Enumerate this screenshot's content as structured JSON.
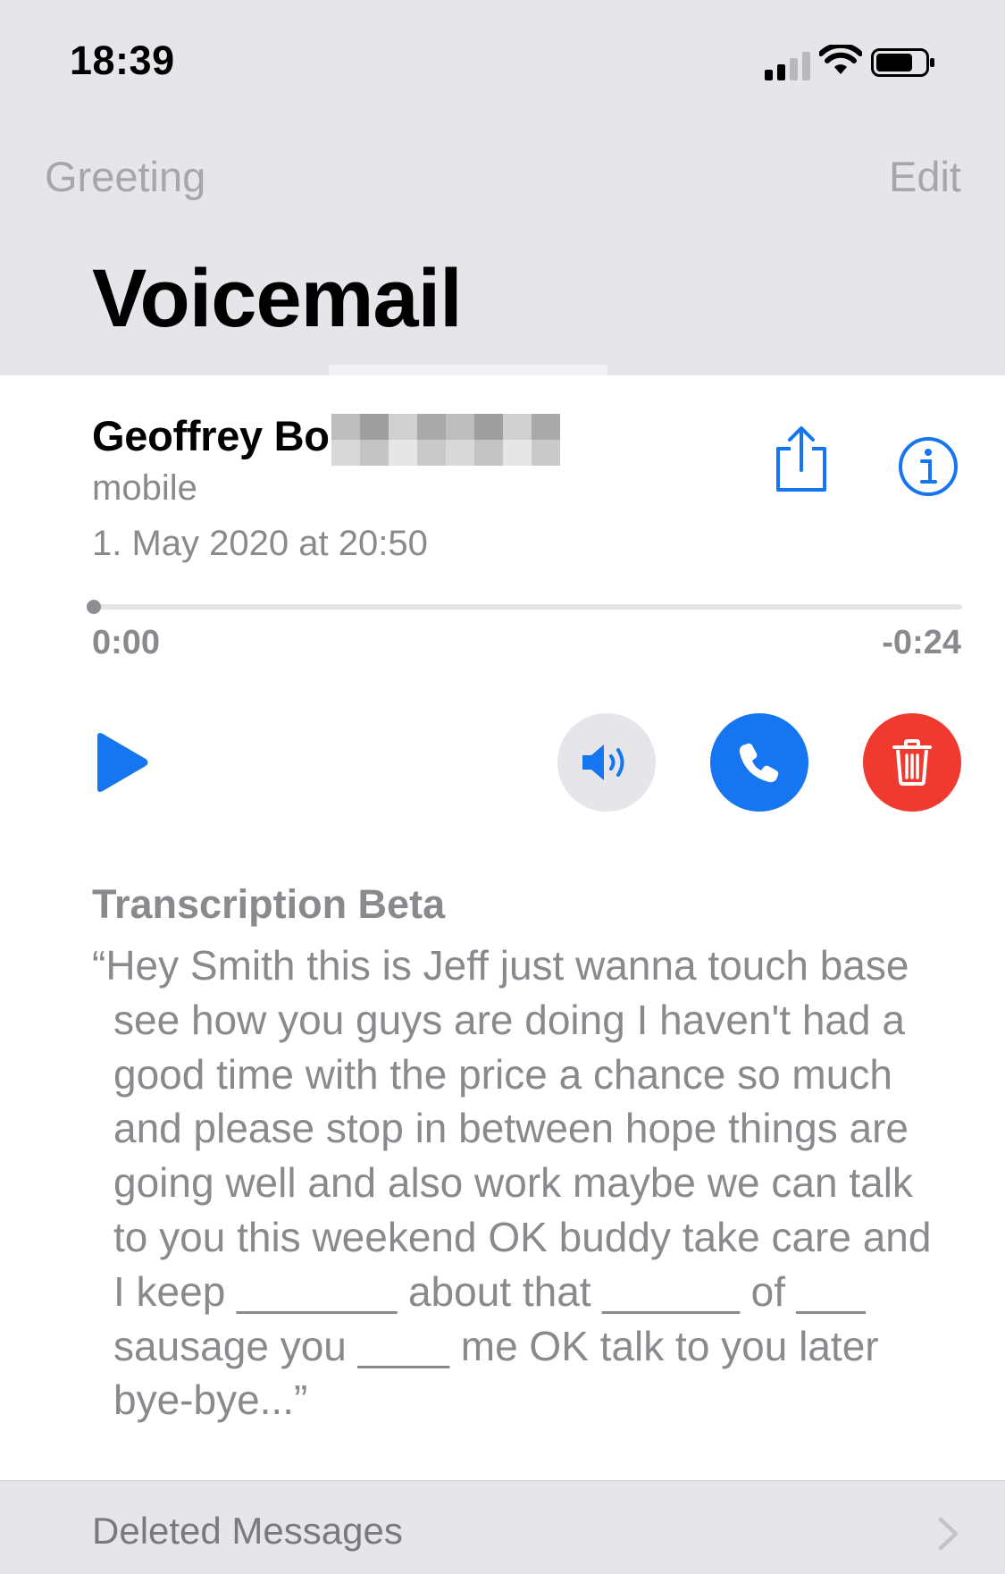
{
  "status_bar": {
    "time": "18:39",
    "icons": [
      "cellular-signal-icon",
      "wifi-icon",
      "battery-icon"
    ]
  },
  "nav": {
    "left_label": "Greeting",
    "right_label": "Edit"
  },
  "page": {
    "title": "Voicemail"
  },
  "voicemail": {
    "caller_name": "Geoffrey Bo",
    "caller_type": "mobile",
    "date": "1. May 2020 at 20:50",
    "elapsed": "0:00",
    "remaining": "-0:24",
    "progress": 0,
    "actions": [
      "share-icon",
      "info-icon",
      "play-icon",
      "speaker-icon",
      "phone-icon",
      "trash-icon"
    ]
  },
  "transcription": {
    "title": "Transcription Beta",
    "text": "“Hey Smith this is Jeff just wanna touch base see how you guys are doing I haven't had a good time with the price a chance so much and please stop in between hope things are going well and also work maybe we can talk to you this weekend OK buddy take care and I keep _______ about that ______ of ___ sausage you ____ me OK talk to you later bye-bye...”"
  },
  "footer": {
    "label": "Deleted Messages"
  },
  "colors": {
    "accent": "#1576f0",
    "delete": "#f03a30",
    "secondary_text": "#8a8a8e",
    "header_bg": "#e6e6ea"
  }
}
